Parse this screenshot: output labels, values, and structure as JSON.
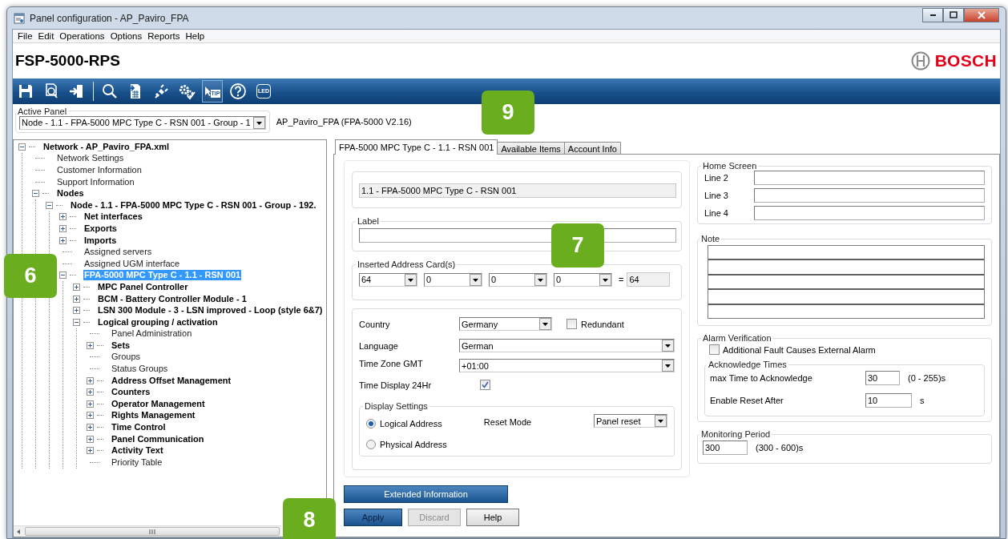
{
  "window": {
    "title": "Panel configuration - AP_Paviro_FPA"
  },
  "menu": [
    {
      "label": "File"
    },
    {
      "label": "Edit"
    },
    {
      "label": "Operations"
    },
    {
      "label": "Options"
    },
    {
      "label": "Reports"
    },
    {
      "label": "Help"
    }
  ],
  "header": {
    "title": "FSP-5000-RPS",
    "brand": "BOSCH"
  },
  "toolbar": [
    {
      "kind": "save",
      "pressed": false
    },
    {
      "kind": "preview",
      "pressed": false
    },
    {
      "kind": "exit",
      "pressed": false
    },
    {
      "kind": "separator"
    },
    {
      "kind": "search",
      "pressed": false
    },
    {
      "kind": "import",
      "pressed": false
    },
    {
      "kind": "connect",
      "pressed": false
    },
    {
      "kind": "settings",
      "pressed": false
    },
    {
      "kind": "tip",
      "label": "TIP",
      "pressed": true
    },
    {
      "kind": "help",
      "pressed": false
    },
    {
      "kind": "led",
      "label": "LED",
      "pressed": false
    }
  ],
  "active_panel": {
    "legend": "Active Panel",
    "value": "Node - 1.1 - FPA-5000 MPC Type C - RSN 001 - Group - 1",
    "info": "AP_Paviro_FPA  (FPA-5000 V2.16)"
  },
  "tree": [
    {
      "label": "Network - AP_Paviro_FPA.xml",
      "kind": "folder",
      "expanded": true,
      "selected": false,
      "children": [
        {
          "label": "Network Settings",
          "kind": "leaf",
          "selected": false
        },
        {
          "label": "Customer Information",
          "kind": "leaf",
          "selected": false
        },
        {
          "label": "Support Information",
          "kind": "leaf",
          "selected": false
        },
        {
          "label": "Nodes",
          "kind": "folder",
          "expanded": true,
          "selected": false,
          "children": [
            {
              "label": "Node - 1.1 - FPA-5000 MPC Type C - RSN 001 - Group - 192.",
              "kind": "folder",
              "expanded": true,
              "selected": false,
              "children": [
                {
                  "label": "Net interfaces",
                  "kind": "folder",
                  "expanded": false,
                  "selected": false
                },
                {
                  "label": "Exports",
                  "kind": "folder",
                  "expanded": false,
                  "selected": false
                },
                {
                  "label": "Imports",
                  "kind": "folder",
                  "expanded": false,
                  "selected": false
                },
                {
                  "label": "Assigned servers",
                  "kind": "leaf",
                  "selected": false
                },
                {
                  "label": "Assigned UGM interface",
                  "kind": "leaf",
                  "selected": false
                },
                {
                  "label": "FPA-5000 MPC Type C - 1.1 - RSN 001",
                  "kind": "folder",
                  "expanded": true,
                  "selected": true,
                  "children": [
                    {
                      "label": "MPC Panel Controller",
                      "kind": "folder",
                      "expanded": false,
                      "selected": false
                    },
                    {
                      "label": "BCM - Battery Controller Module - 1",
                      "kind": "folder",
                      "expanded": false,
                      "selected": false
                    },
                    {
                      "label": "LSN 300 Module - 3 - LSN improved - Loop (style 6&7)",
                      "kind": "folder",
                      "expanded": false,
                      "selected": false
                    },
                    {
                      "label": "Logical grouping / activation",
                      "kind": "folder",
                      "expanded": true,
                      "selected": false,
                      "children": [
                        {
                          "label": "Panel Administration",
                          "kind": "leaf",
                          "selected": false
                        },
                        {
                          "label": "Sets",
                          "kind": "folder",
                          "expanded": false,
                          "selected": false
                        },
                        {
                          "label": "Groups",
                          "kind": "leaf",
                          "selected": false
                        },
                        {
                          "label": "Status Groups",
                          "kind": "leaf",
                          "selected": false
                        },
                        {
                          "label": "Address Offset Management",
                          "kind": "folder",
                          "expanded": false,
                          "selected": false
                        },
                        {
                          "label": "Counters",
                          "kind": "folder",
                          "expanded": false,
                          "selected": false
                        },
                        {
                          "label": "Operator Management",
                          "kind": "folder",
                          "expanded": false,
                          "selected": false
                        },
                        {
                          "label": "Rights Management",
                          "kind": "folder",
                          "expanded": false,
                          "selected": false
                        },
                        {
                          "label": "Time Control",
                          "kind": "folder",
                          "expanded": false,
                          "selected": false
                        },
                        {
                          "label": "Panel Communication",
                          "kind": "folder",
                          "expanded": false,
                          "selected": false
                        },
                        {
                          "label": "Activity Text",
                          "kind": "folder",
                          "expanded": false,
                          "selected": false
                        },
                        {
                          "label": "Priority Table",
                          "kind": "leaf",
                          "selected": false
                        }
                      ]
                    }
                  ]
                }
              ]
            }
          ]
        }
      ]
    }
  ],
  "tabs": [
    {
      "label": "FPA-5000 MPC Type C - 1.1 - RSN 001",
      "selected": true
    },
    {
      "label": "Available Items",
      "selected": false
    },
    {
      "label": "Account Info",
      "selected": false
    }
  ],
  "form": {
    "name_field": "1.1 - FPA-5000 MPC Type C - RSN 001",
    "label": {
      "legend": "Label"
    },
    "address_cards": {
      "legend": "Inserted Address Card(s)",
      "cards": [
        "64",
        "0",
        "0",
        "0"
      ],
      "equals": "=",
      "total": "64"
    },
    "country": {
      "label": "Country",
      "value": "Germany"
    },
    "redundant": {
      "label": "Redundant",
      "checked": false
    },
    "language": {
      "label": "Language",
      "value": "German"
    },
    "time_zone": {
      "label": "Time Zone GMT",
      "value": "+01:00"
    },
    "time_display": {
      "label": "Time Display 24Hr",
      "checked": true
    },
    "display_settings": {
      "legend": "Display Settings",
      "options": [
        {
          "label": "Logical Address",
          "selected": true
        },
        {
          "label": "Physical Address",
          "selected": false
        }
      ],
      "reset_mode": {
        "label": "Reset Mode",
        "value": "Panel reset"
      }
    },
    "buttons": [
      {
        "label": "Extended Information",
        "kind": "wide",
        "disabled": false
      },
      {
        "label": "Apply",
        "kind": "primary",
        "disabled": false
      },
      {
        "label": "Discard",
        "kind": "normal",
        "disabled": true
      },
      {
        "label": "Help",
        "kind": "normal",
        "disabled": false
      }
    ]
  },
  "home_screen": {
    "legend": "Home Screen",
    "lines": [
      {
        "label": "Line 2"
      },
      {
        "label": "Line 3"
      },
      {
        "label": "Line 4"
      }
    ]
  },
  "note": {
    "legend": "Note"
  },
  "alarm_verification": {
    "legend": "Alarm Verification",
    "fault_alarm": {
      "label": "Additional Fault Causes External Alarm",
      "checked": false
    },
    "acknowledge_times": {
      "legend": "Acknowledge Times",
      "rows": [
        {
          "label": "max Time to Acknowledge",
          "value": "30",
          "range": "(0 - 255)s"
        },
        {
          "label": "Enable Reset After",
          "value": "10",
          "range": "s"
        }
      ]
    }
  },
  "monitoring_period": {
    "legend": "Monitoring Period",
    "value": "300",
    "range": "(300 - 600)s"
  },
  "callouts": [
    {
      "label": "6"
    },
    {
      "label": "7"
    },
    {
      "label": "8"
    },
    {
      "label": "9"
    }
  ]
}
